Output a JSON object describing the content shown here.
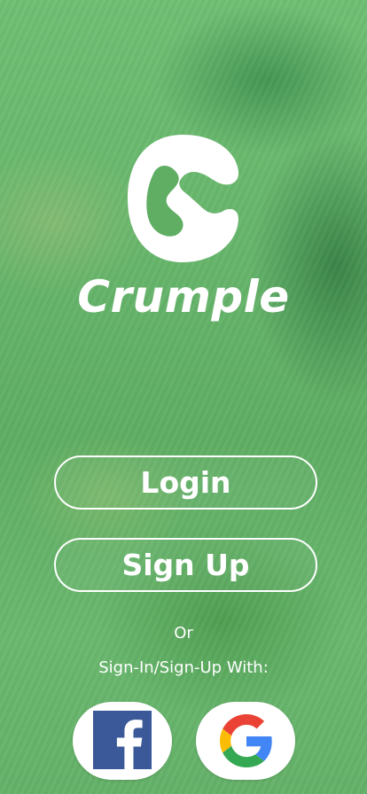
{
  "app": {
    "name": "Crumple"
  },
  "auth": {
    "login_label": "Login",
    "signup_label": "Sign Up",
    "or_label": "Or",
    "social_caption": "Sign-In/Sign-Up With:"
  },
  "social": {
    "facebook_icon": "facebook-icon",
    "google_icon": "google-icon"
  },
  "colors": {
    "background_overlay": "#66b56b",
    "text": "#ffffff",
    "facebook": "#3b5998",
    "google_blue": "#4285F4",
    "google_red": "#EA4335",
    "google_yellow": "#FBBC05",
    "google_green": "#34A853"
  }
}
